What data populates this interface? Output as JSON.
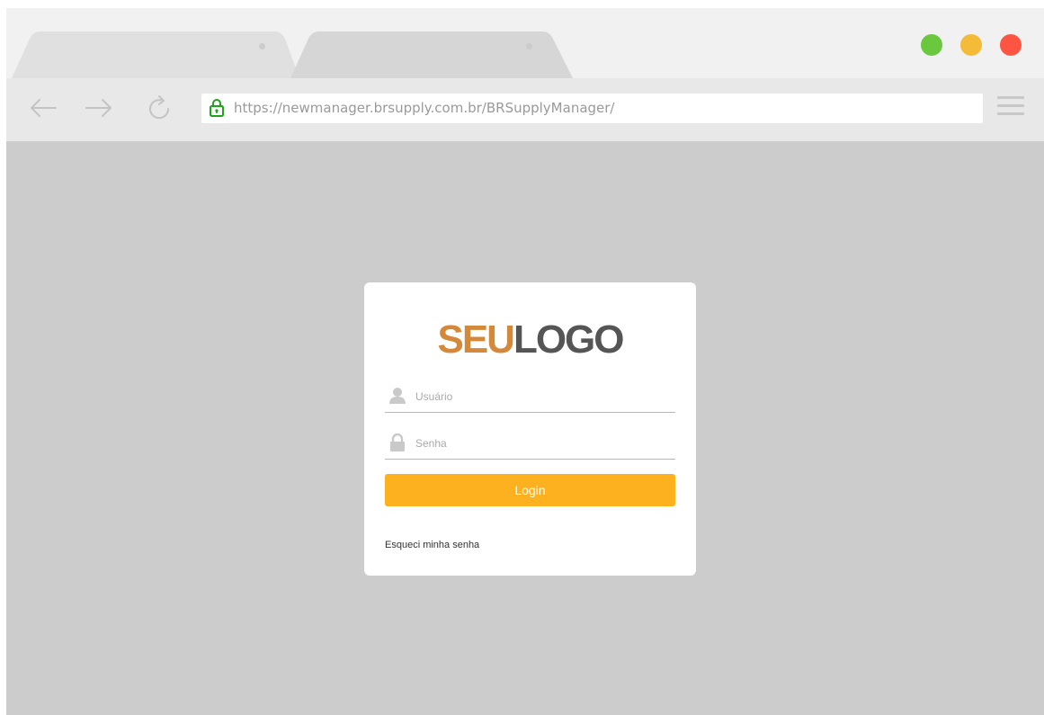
{
  "browser": {
    "tabs": [
      {
        "label": ""
      },
      {
        "label": ""
      }
    ],
    "window_controls": {
      "minimize_color": "#6ac83f",
      "maximize_color": "#f4bb39",
      "close_color": "#fe5442"
    },
    "nav": {
      "back_icon": "arrow-left-icon",
      "forward_icon": "arrow-right-icon",
      "reload_icon": "reload-icon",
      "menu_icon": "hamburger-menu-icon"
    },
    "address": {
      "url": "https://newmanager.brsupply.com.br/BRSupplyManager/",
      "secure_icon": "lock-icon",
      "secure_color": "#1aa51a"
    }
  },
  "login": {
    "logo_part1": "SEU",
    "logo_part2": "LOGO",
    "username_placeholder": "Usuário",
    "password_placeholder": "Senha",
    "login_button": "Login",
    "forgot_link": "Esqueci minha senha",
    "accent_color": "#fdb11f"
  }
}
